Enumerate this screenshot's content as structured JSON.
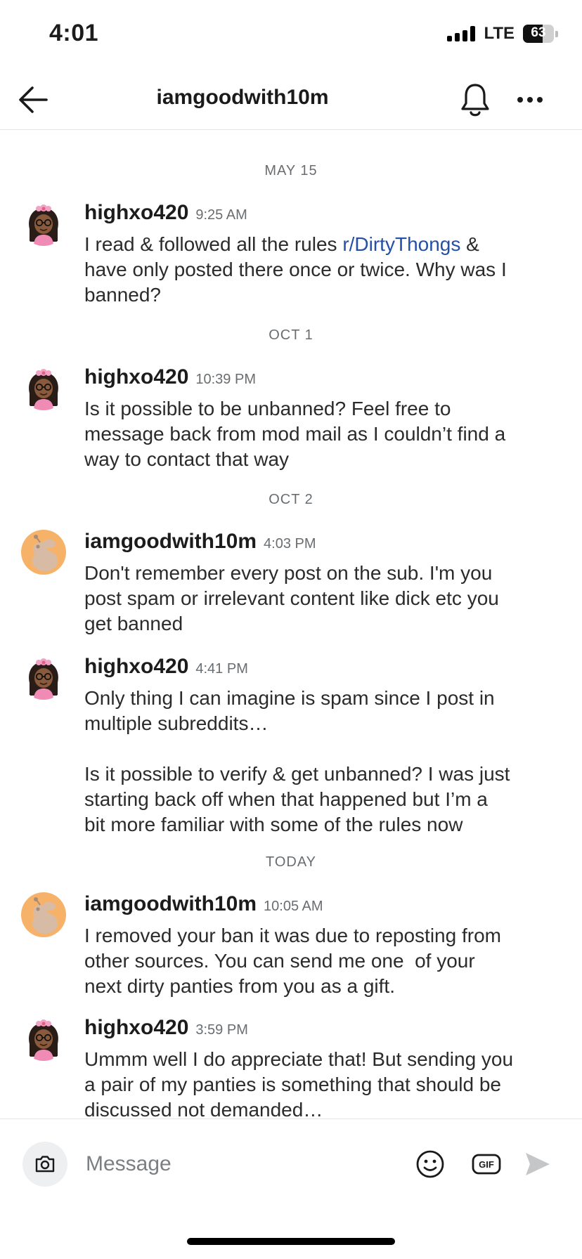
{
  "status_bar": {
    "time": "4:01",
    "network": "LTE",
    "battery": "63",
    "battery_level": 0.63
  },
  "header": {
    "title": "iamgoodwith10m",
    "back_icon": "back-arrow-icon",
    "bell_icon": "bell-icon",
    "more_icon": "more-horizontal-icon"
  },
  "thread": {
    "date_separators": [
      "MAY 15",
      "OCT 1",
      "OCT 2",
      "TODAY"
    ],
    "messages": [
      {
        "user": "highxo420",
        "time": "9:25 AM",
        "text_before": "I read & followed all the rules ",
        "link": "r/DirtyThongs",
        "text_after": " &\nhave only posted there once or twice. Why was I\nbanned?"
      },
      {
        "user": "highxo420",
        "time": "10:39 PM",
        "text": "Is it possible to be unbanned? Feel free to\nmessage back from mod mail as I couldn’t find a\nway to contact that way"
      },
      {
        "user": "iamgoodwith10m",
        "time": "4:03 PM",
        "text": "Don't remember every post on the sub. I'm you\npost spam or irrelevant content like dick etc you\nget banned"
      },
      {
        "user": "highxo420",
        "time": "4:41 PM",
        "text": "Only thing I can imagine is spam since I post in\nmultiple subreddits…\n\nIs it possible to verify & get unbanned? I was just\nstarting back off when that happened but I’m a\nbit more familiar with some of the rules now"
      },
      {
        "user": "iamgoodwith10m",
        "time": "10:05 AM",
        "text": "I removed your ban it was due to reposting from\nother sources. You can send me one  of your\nnext dirty panties from you as a gift."
      },
      {
        "user": "highxo420",
        "time": "3:59 PM",
        "text": "Ummm well I do appreciate that! But sending you\na pair of my panties is something that should be\ndiscussed not demanded…"
      }
    ]
  },
  "composer": {
    "placeholder": "Message",
    "camera_icon": "camera-icon",
    "emoji_icon": "emoji-icon",
    "gif_label": "GIF",
    "send_icon": "send-icon"
  },
  "colors": {
    "link": "#2450a6",
    "avatar_orange": "#f7b26a",
    "timestamp": "#6a6d70",
    "divider": "#e6e6e6"
  }
}
